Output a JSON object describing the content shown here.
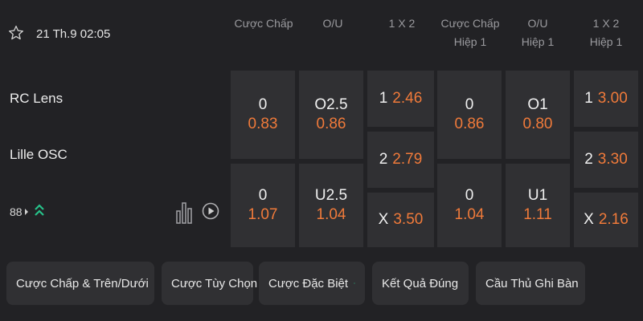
{
  "match": {
    "datetime": "21 Th.9 02:05",
    "home_team": "RC Lens",
    "away_team": "Lille OSC",
    "more_markets_count": "88"
  },
  "columns": [
    {
      "line1": "Cược Chấp",
      "line2": ""
    },
    {
      "line1": "O/U",
      "line2": ""
    },
    {
      "line1": "1 X 2",
      "line2": ""
    },
    {
      "line1": "Cược Chấp",
      "line2": "Hiệp 1"
    },
    {
      "line1": "O/U",
      "line2": "Hiệp 1"
    },
    {
      "line1": "1 X 2",
      "line2": "Hiệp 1"
    }
  ],
  "odds": {
    "handicap_home": {
      "line": "0",
      "price": "0.83"
    },
    "handicap_away": {
      "line": "0",
      "price": "1.07"
    },
    "ou_over": {
      "line": "O2.5",
      "price": "0.86"
    },
    "ou_under": {
      "line": "U2.5",
      "price": "1.04"
    },
    "x12_home": {
      "label": "1",
      "price": "2.46"
    },
    "x12_away": {
      "label": "2",
      "price": "2.79"
    },
    "x12_draw": {
      "label": "X",
      "price": "3.50"
    },
    "h1_handicap_home": {
      "line": "0",
      "price": "0.86"
    },
    "h1_handicap_away": {
      "line": "0",
      "price": "1.04"
    },
    "h1_ou_over": {
      "line": "O1",
      "price": "0.80"
    },
    "h1_ou_under": {
      "line": "U1",
      "price": "1.11"
    },
    "h1_x12_home": {
      "label": "1",
      "price": "3.00"
    },
    "h1_x12_away": {
      "label": "2",
      "price": "3.30"
    },
    "h1_x12_draw": {
      "label": "X",
      "price": "2.16"
    }
  },
  "tabs": [
    {
      "label": "Cược Chấp & Trên/Dưới",
      "icon": "chevron-down-icon"
    },
    {
      "label": "Cược Tùy Chọn",
      "icon": ""
    },
    {
      "label": "Cược Đặc Biệt",
      "icon": "double-chevron-up-icon"
    },
    {
      "label": "Kết Quả Đúng",
      "icon": "chevron-down-icon"
    },
    {
      "label": "Cầu Thủ Ghi Bàn",
      "icon": "chevron-down-icon"
    }
  ],
  "colors": {
    "background": "#222225",
    "cell": "#303033",
    "odds": "#f07a3a",
    "accent_green": "#27c28a",
    "muted_text": "#9a9a9e"
  }
}
